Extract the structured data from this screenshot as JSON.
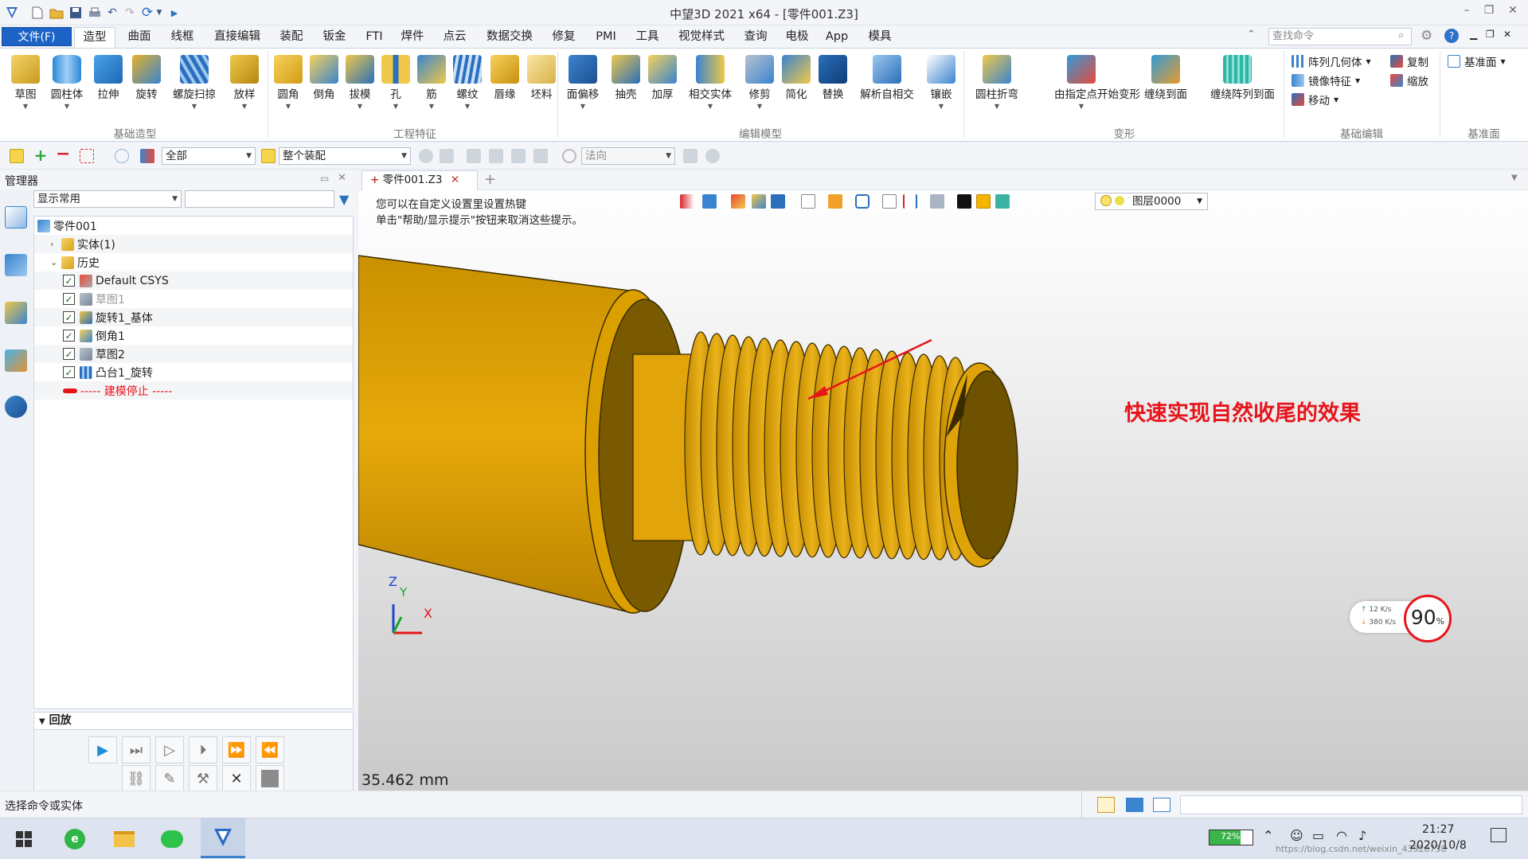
{
  "window": {
    "title": "中望3D 2021 x64 - [零件001.Z3]"
  },
  "menu": {
    "file": "文件(F)",
    "tabs": [
      "造型",
      "曲面",
      "线框",
      "直接编辑",
      "装配",
      "钣金",
      "FTI",
      "焊件",
      "点云",
      "数据交换",
      "修复",
      "PMI",
      "工具",
      "视觉样式",
      "查询",
      "电极",
      "App",
      "模具"
    ],
    "active_tab": "造型",
    "search_placeholder": "查找命令"
  },
  "ribbon": {
    "groups": [
      {
        "label": "基础造型",
        "buttons": [
          "草图",
          "圆柱体",
          "拉伸",
          "旋转",
          "螺旋扫掠",
          "放样"
        ]
      },
      {
        "label": "工程特征",
        "buttons": [
          "圆角",
          "倒角",
          "拔模",
          "孔",
          "筋",
          "螺纹",
          "唇缘",
          "坯料"
        ]
      },
      {
        "label": "编辑模型",
        "buttons": [
          "面偏移",
          "抽壳",
          "加厚",
          "相交实体",
          "修剪",
          "简化",
          "替换",
          "解析自相交",
          "镶嵌"
        ]
      },
      {
        "label": "变形",
        "buttons": [
          "圆柱折弯",
          "由指定点开始变形",
          "缠绕到面",
          "缠绕阵列到面"
        ]
      },
      {
        "label": "基础编辑",
        "items": [
          "阵列几何体",
          "镜像特征",
          "移动",
          "复制",
          "缩放"
        ]
      },
      {
        "label": "基准面",
        "items": [
          "基准面"
        ]
      }
    ]
  },
  "toolbar2": {
    "filter": "全部",
    "scope": "整个装配",
    "direction": "法向"
  },
  "manager": {
    "title": "管理器",
    "display_combo": "显示常用",
    "tree": [
      {
        "label": "零件001",
        "indent": 0,
        "expander": "",
        "check": false,
        "icon": "part-icon"
      },
      {
        "label": "实体(1)",
        "indent": 1,
        "expander": ">",
        "check": false,
        "icon": "folder-icon"
      },
      {
        "label": "历史",
        "indent": 1,
        "expander": "v",
        "check": false,
        "icon": "folder-icon"
      },
      {
        "label": "Default CSYS",
        "indent": 2,
        "expander": "",
        "check": true,
        "icon": "csys-icon"
      },
      {
        "label": "草图1",
        "indent": 2,
        "expander": "",
        "check": true,
        "icon": "sketch-icon",
        "muted": true
      },
      {
        "label": "旋转1_基体",
        "indent": 2,
        "expander": "",
        "check": true,
        "icon": "revolve-icon"
      },
      {
        "label": "倒角1",
        "indent": 2,
        "expander": "",
        "check": true,
        "icon": "chamfer-icon"
      },
      {
        "label": "草图2",
        "indent": 2,
        "expander": "",
        "check": true,
        "icon": "sketch-icon"
      },
      {
        "label": "凸台1_旋转",
        "indent": 2,
        "expander": "",
        "check": true,
        "icon": "boss-icon"
      },
      {
        "label": "----- 建模停止 -----",
        "indent": 2,
        "expander": "",
        "check": false,
        "icon": "stop-arrow-icon",
        "stop": true
      }
    ],
    "playback_label": "回放"
  },
  "viewport": {
    "doc_tab": "零件001.Z3",
    "hint_line1": "您可以在自定义设置里设置热键",
    "hint_line2": "单击\"帮助/显示提示\"按钮来取消这些提示。",
    "layer": "图层0000",
    "annotation": "快速实现自然收尾的效果",
    "measurement": "35.462 mm",
    "axis_x": "X",
    "axis_y": "Y",
    "axis_z": "Z",
    "net_up": "12  K/s",
    "net_down": "380 K/s",
    "percent": "90",
    "percent_unit": "%"
  },
  "status": {
    "text": "选择命令或实体"
  },
  "taskbar": {
    "battery": "72%",
    "time": "21:27",
    "date": "2020/10/8",
    "watermark": "https://blog.csdn.net/weixin_43928738"
  },
  "colors": {
    "accent": "#1d63c6",
    "part": "#e2a40a",
    "annotation": "#e8141b"
  }
}
